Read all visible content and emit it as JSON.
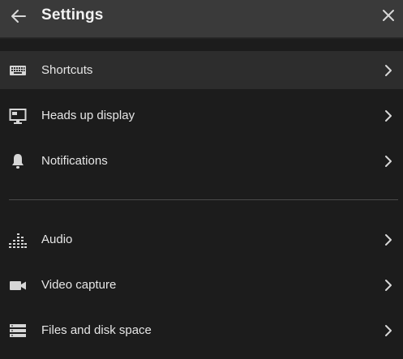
{
  "header": {
    "title": "Settings",
    "back_icon": "arrow-left-icon",
    "close_icon": "close-icon"
  },
  "menu": {
    "groups": [
      {
        "items": [
          {
            "label": "Shortcuts",
            "icon": "keyboard-icon",
            "selected": true
          },
          {
            "label": "Heads up display",
            "icon": "monitor-icon",
            "selected": false
          },
          {
            "label": "Notifications",
            "icon": "bell-icon",
            "selected": false
          }
        ]
      },
      {
        "items": [
          {
            "label": "Audio",
            "icon": "equalizer-icon",
            "selected": false
          },
          {
            "label": "Video capture",
            "icon": "video-camera-icon",
            "selected": false
          },
          {
            "label": "Files and disk space",
            "icon": "storage-icon",
            "selected": false
          }
        ]
      }
    ]
  },
  "colors": {
    "background": "#1c1c1c",
    "header_background": "#3a3a3a",
    "selected_row": "#2d2d2d",
    "text": "#e6e6e6",
    "divider": "#4a4a4a"
  }
}
